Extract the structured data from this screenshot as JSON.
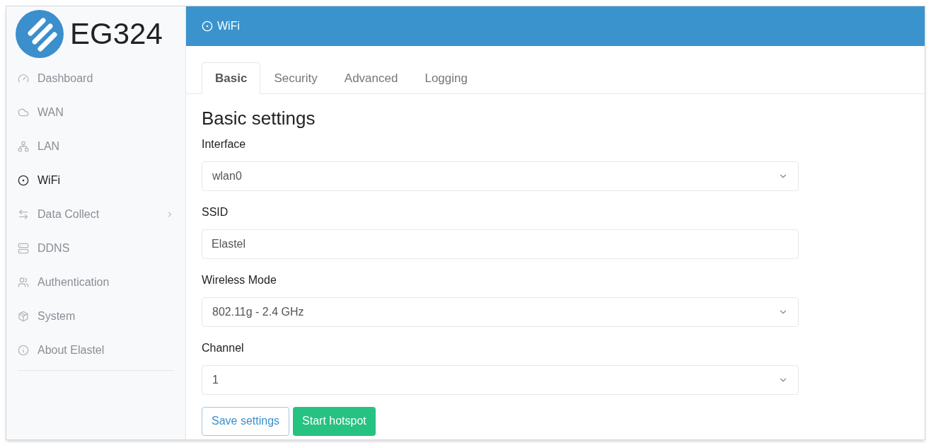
{
  "sidebar": {
    "logo_text": "EG324",
    "items": [
      {
        "label": "Dashboard",
        "selected": false,
        "has_submenu": false
      },
      {
        "label": "WAN",
        "selected": false,
        "has_submenu": false
      },
      {
        "label": "LAN",
        "selected": false,
        "has_submenu": false
      },
      {
        "label": "WiFi",
        "selected": true,
        "has_submenu": false
      },
      {
        "label": "Data Collect",
        "selected": false,
        "has_submenu": true
      },
      {
        "label": "DDNS",
        "selected": false,
        "has_submenu": false
      },
      {
        "label": "Authentication",
        "selected": false,
        "has_submenu": false
      },
      {
        "label": "System",
        "selected": false,
        "has_submenu": false
      },
      {
        "label": "About Elastel",
        "selected": false,
        "has_submenu": false
      }
    ]
  },
  "header": {
    "title": "WiFi"
  },
  "tabs": [
    {
      "label": "Basic",
      "selected": true
    },
    {
      "label": "Security",
      "selected": false
    },
    {
      "label": "Advanced",
      "selected": false
    },
    {
      "label": "Logging",
      "selected": false
    }
  ],
  "form": {
    "heading": "Basic settings",
    "fields": [
      {
        "label": "Interface",
        "kind": "select",
        "value": "wlan0"
      },
      {
        "label": "SSID",
        "kind": "text",
        "value": "Elastel"
      },
      {
        "label": "Wireless Mode",
        "kind": "select",
        "value": "802.11g - 2.4 GHz"
      },
      {
        "label": "Channel",
        "kind": "select",
        "value": "1"
      }
    ],
    "buttons": [
      {
        "label": "Save settings",
        "kind": "outline"
      },
      {
        "label": "Start hotspot",
        "kind": "primary"
      }
    ]
  }
}
